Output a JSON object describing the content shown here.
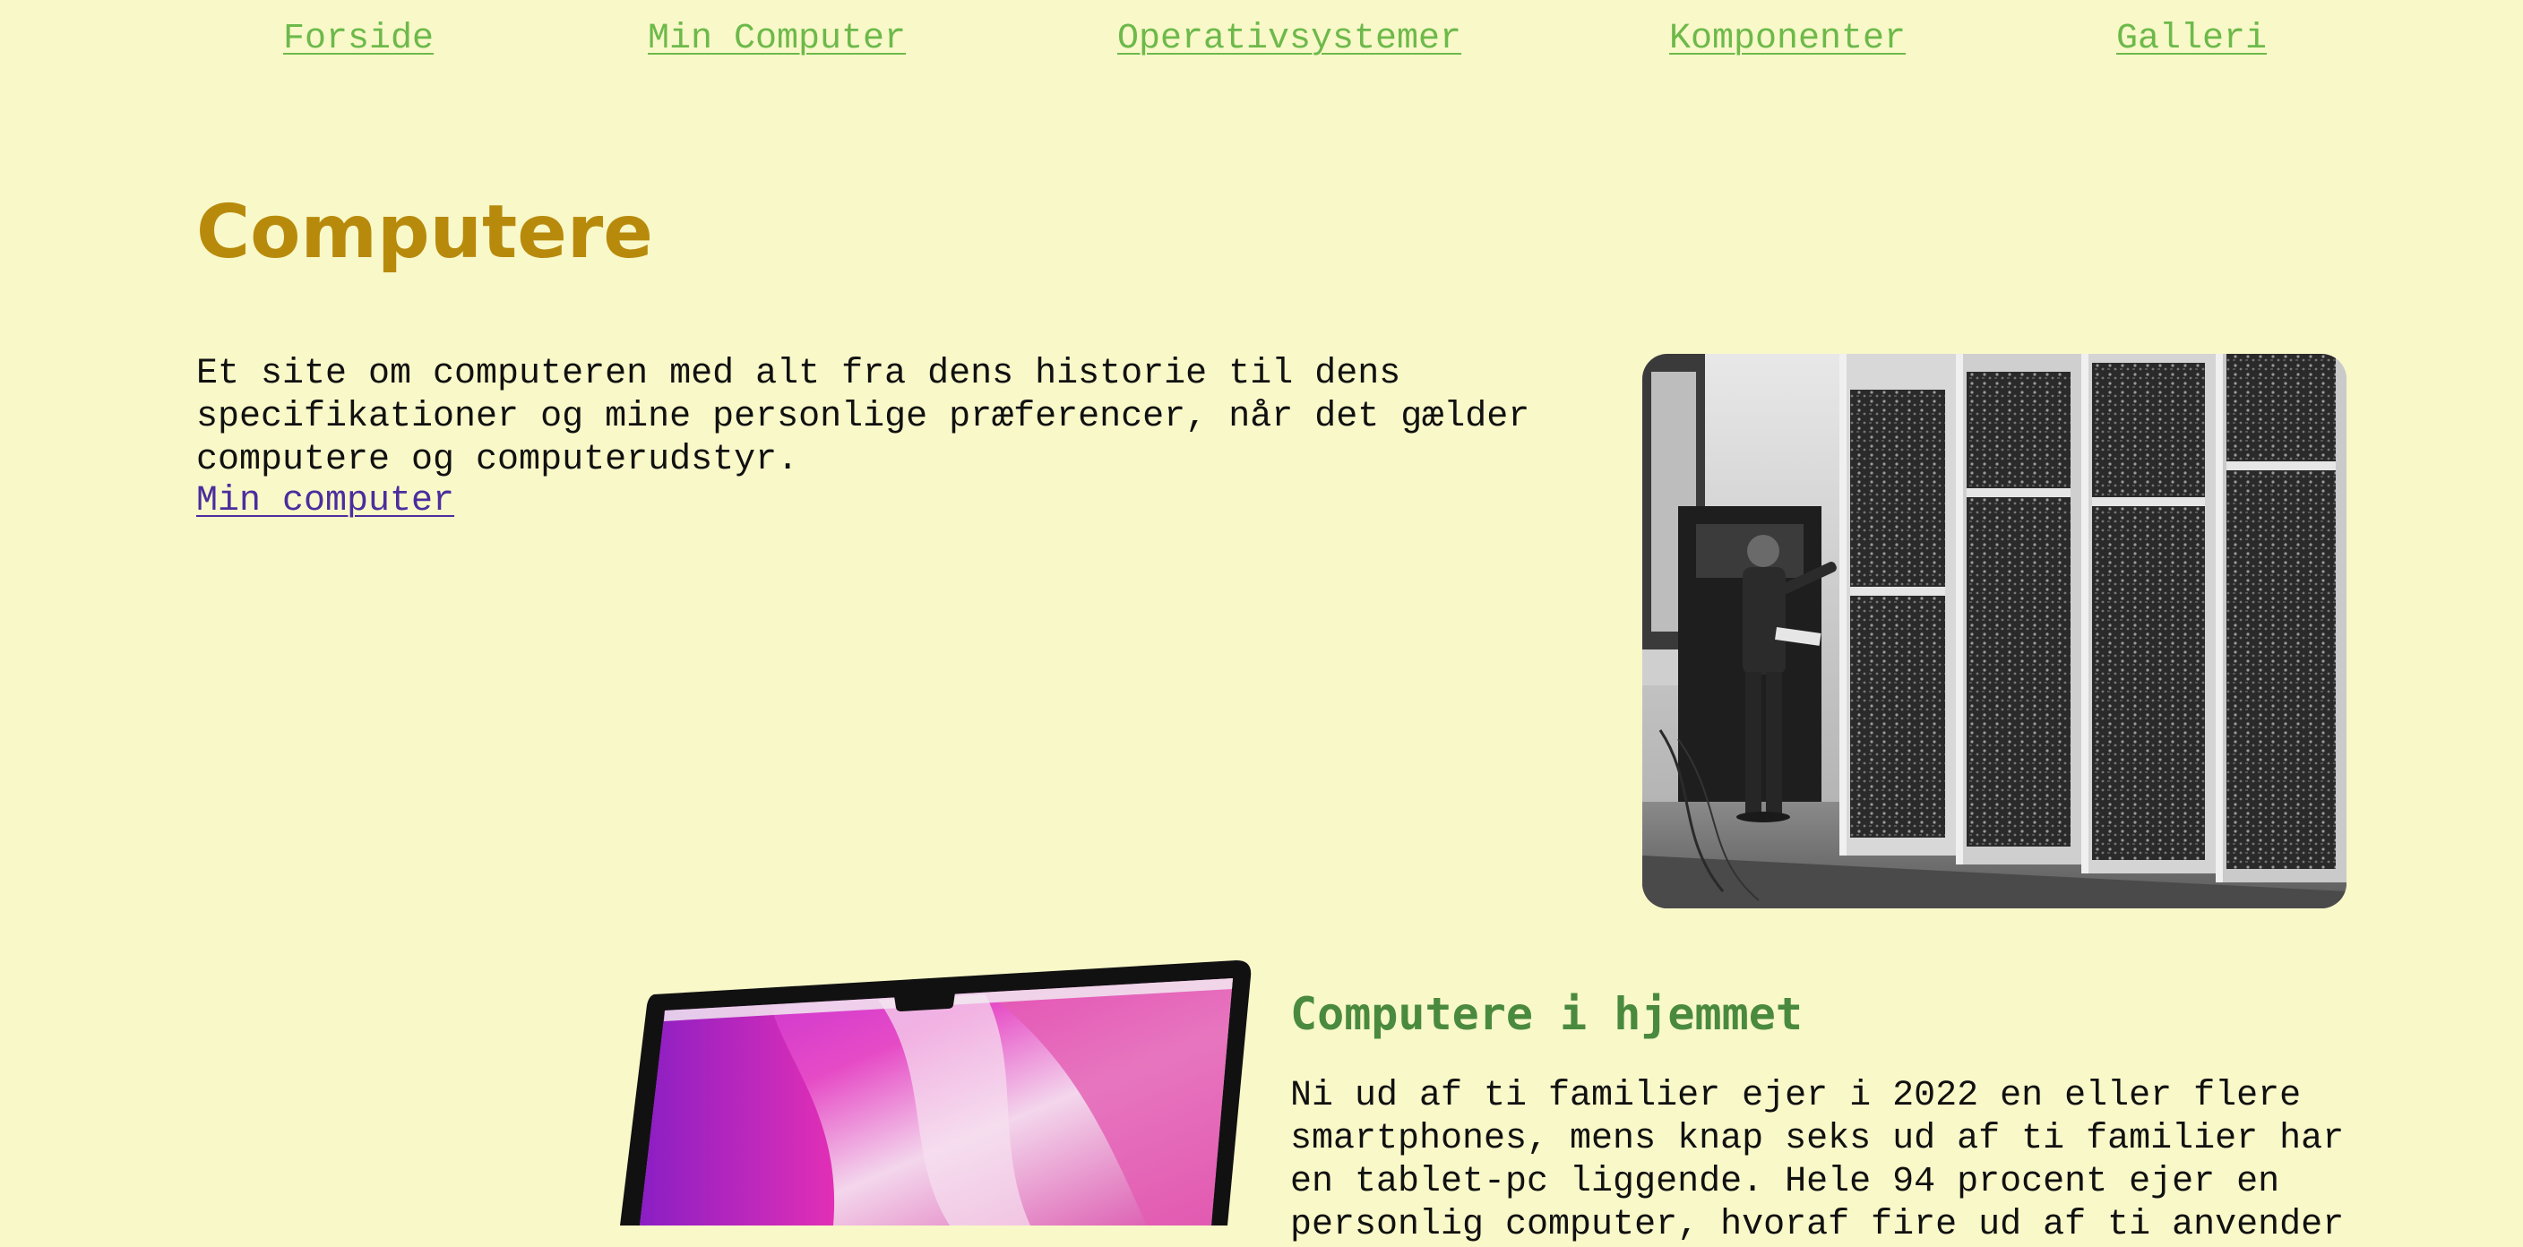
{
  "nav": {
    "items": [
      {
        "label": "Forside"
      },
      {
        "label": "Min Computer"
      },
      {
        "label": "Operativsystemer"
      },
      {
        "label": "Komponenter"
      },
      {
        "label": "Galleri"
      }
    ]
  },
  "hero": {
    "title": "Computere",
    "intro_lines": [
      "Et site om computeren med alt fra dens historie til dens",
      "specifikationer og mine personlige præferencer, når det gælder",
      "computere og computerudstyr."
    ],
    "link_label": "Min computer"
  },
  "section": {
    "title": "Computere i hjemmet",
    "text_lines": [
      "Ni ud af ti familier ejer i 2022 en eller flere",
      "smartphones, mens knap seks ud af ti familier har",
      "en tablet-pc liggende. Hele 94 procent ejer en",
      "personlig computer, hvoraf fire ud af ti anvender"
    ]
  },
  "colors": {
    "background": "#f8f8c9",
    "nav_link": "#6db94a",
    "title": "#b88a0c",
    "section_title": "#4a8a3e",
    "visited_link": "#4b2d9e"
  }
}
